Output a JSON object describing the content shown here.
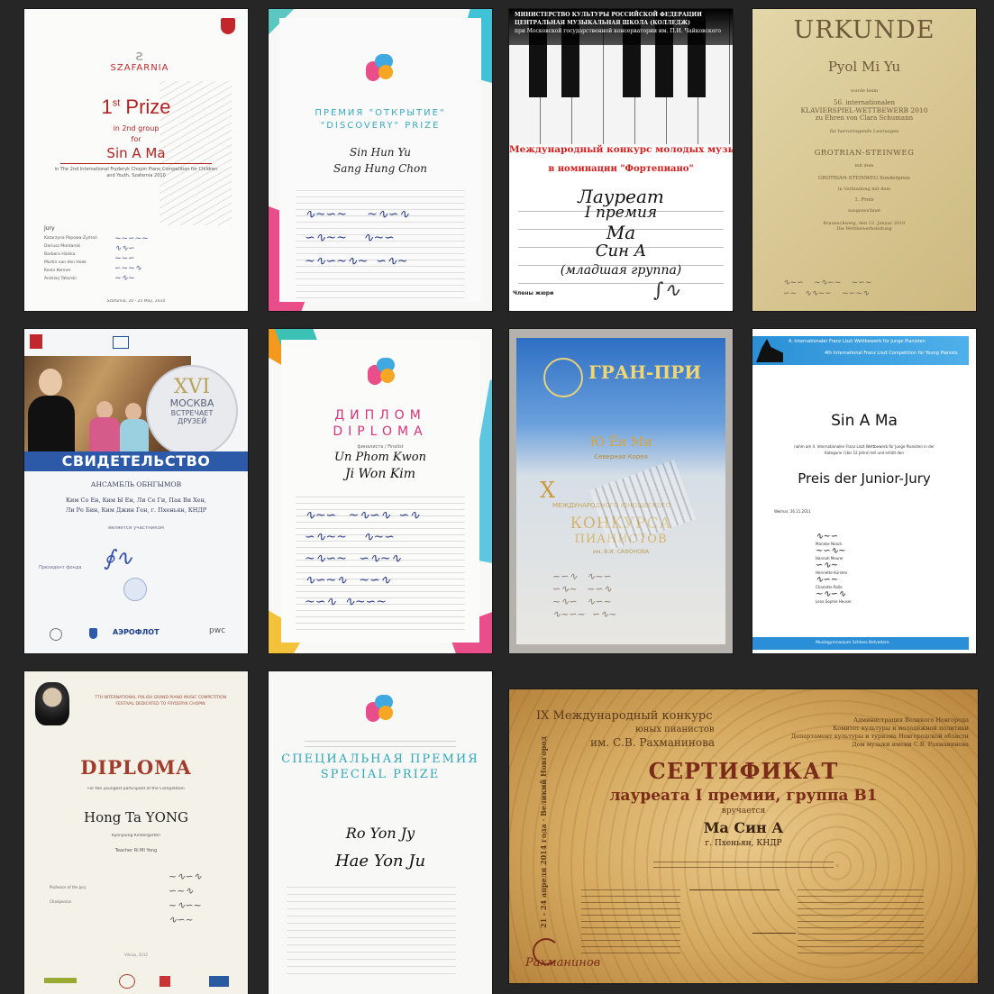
{
  "certificates": [
    {
      "logo": "SZAFARNIA",
      "prize": "1",
      "prize_sup": "st",
      "prize_word": "Prize",
      "group_line": "in 2nd group",
      "for": "for",
      "name": "Sin A Ma",
      "competition": "in The 2nd International Fryderyk Chopin Piano Competition for Children and Youth, Szafarnia 2010",
      "jury": "Jury",
      "jury_names": [
        "Katarzyna Popowa-Zydroń",
        "Dariusz Mordarski",
        "Barbara Halska",
        "Martin van den Hoek",
        "Kevin Kenner",
        "Andrzej Tatarski"
      ],
      "date": "Szafarnia, 20 - 25 May, 2010"
    },
    {
      "title_ru": "ПРЕМИЯ \"ОТКРЫТИЕ\"",
      "title_en": "\"DISCOVERY\" PRIZE",
      "sig1": "Sin Hun Yu",
      "sig2": "Sang Hung Chon"
    },
    {
      "header1": "МИНИСТЕРСТВО КУЛЬТУРЫ РОССИЙСКОЙ ФЕДЕРАЦИИ",
      "header2": "ЦЕНТРАЛЬНАЯ МУЗЫКАЛЬНАЯ ШКОЛА (КОЛЛЕДЖ)",
      "header3": "при Московской государственной консерватории им. П.И. Чайковского",
      "banner": "Международный конкурс молодых музыкантов",
      "nomination": "в номинации \"Фортепиано\"",
      "hw1": "Лауреат",
      "hw2": "I премия",
      "hw3": "Ма",
      "hw4": "Син А",
      "hw5": "(младшая группа)",
      "footer": "Члены жюри"
    },
    {
      "title": "URKUNDE",
      "name": "Pyol Mi Yu",
      "line1": "wurde beim",
      "line2": "56. internationalen",
      "line3": "KLAVIERSPIEL-WETTBEWERB 2010",
      "line4": "zu Ehren von Clara Schumann",
      "line5": "für hervorragende Leistungen",
      "brand": "GROTRIAN-STEINWEG",
      "line6": "mit dem",
      "line7": "GROTRIAN-STEINWEG Sonderpreis",
      "line8": "in Verbindung mit dem",
      "line9": "1. Preis",
      "line10": "ausgezeichnet",
      "line11": "Braunschweig, den 22. Januar 2010",
      "line12": "Die Wettbewerbsleitung"
    },
    {
      "badge": "XVI",
      "city1": "МОСКВА",
      "city2": "ВСТРЕЧАЕТ",
      "city3": "ДРУЗЕЙ",
      "banner": "СВИДЕТЕЛЬСТВО",
      "ensemble": "АНСАМБЛЬ ОБНГЫМОВ",
      "names1": "Ким Со Ен, Ким Ы Ен, Ли Се Ги, Пак Ви Хен,",
      "names2": "Ли Ре Бин, Ким Джин Ген, г. Пхеньян, КНДР",
      "participant": "является участником",
      "president": "Президент фонда",
      "sponsor": "АЭРОФЛОТ",
      "sponsor2": "pwc"
    },
    {
      "title_ru": "ДИПЛОМ",
      "title_en": "DIPLOMA",
      "finalist": "финалиста / Finalist",
      "sig1": "Un Phom Kwon",
      "sig2": "Ji Won Kim"
    },
    {
      "title": "ГРАН-ПРИ",
      "name": "Ю Ён Ми",
      "country": "Северная Корея",
      "numeral": "X",
      "line1": "МЕЖДУНАРОДНОГО ЮНОШЕСКОГО",
      "line2": "КОНКУРСА",
      "line3": "ПИАНИСТОВ",
      "line4": "им. В.И. САФОНОВА"
    },
    {
      "header": "4. Internationaler Franz Liszt Wettbewerb für Junge Pianisten",
      "subheader": "4th International Franz Liszt Competition for Young Pianists",
      "name": "Sin A Ma",
      "desc1": "nahm am 4. Internationalen Franz Liszt Wettbewerb für Junge Pianisten in der",
      "desc2": "Kategorie I (bis 12 Jahre) teil und erhält den",
      "prize": "Preis der Junior-Jury",
      "date": "Weimar, 26.11.2011",
      "jury": [
        "Marieke Noack",
        "Hannah Meurer",
        "Henriette Kürsten",
        "Charlotte Rolle",
        "Lena Sophie Heuser"
      ],
      "footer": "Musikgymnasium Schloss Belvedere"
    },
    {
      "header1": "7TH INTERNATIONAL POLISH GRAND PIANO MUSIC COMPETITION",
      "header2": "FESTIVAL DEDICATED TO FRYDERYK CHOPIN",
      "title": "DIPLOMA",
      "subtitle": "For the youngest participant of the Competition",
      "name": "Hong Ta YONG",
      "school": "Kyonjoong Kindergarten",
      "teacher": "Teacher Ri Mi Yong",
      "left1": "Professor of the Jury",
      "left2": "Chairperson",
      "date": "Vilnius, 2012"
    },
    {
      "title_ru": "СПЕЦИАЛЬНАЯ ПРЕМИЯ",
      "title_en": "SPECIAL PRIZE",
      "sig1": "Ro Yon Jy",
      "sig2": "Hae Yon Ju"
    },
    {
      "top_left1": "IX Международный конкурс",
      "top_left2": "юных пианистов",
      "top_left3": "им. С.В. Рахманинова",
      "top_right1": "Администрация Великого Новгорода",
      "top_right2": "Комитет культуры и молодёжной политики",
      "top_right3": "Департамент культуры и туризма Новгородской области",
      "top_right4": "Дом музыки имени С.В. Рахманинова",
      "side": "21 - 24 апреля 2014 года · Великий Новгород",
      "title": "СЕРТИФИКАТ",
      "line1": "лауреата I премии, группа В1",
      "line2": "вручается",
      "name": "Ма Син А",
      "city": "г. Пхеньян, КНДР",
      "signature": "Рахманинов"
    }
  ],
  "colors": {
    "background": "#262626",
    "gold": "#d9c692",
    "crimson": "#b22222",
    "blue_banner": "#2c5aa8",
    "liszt_blue": "#2a8fd6"
  }
}
